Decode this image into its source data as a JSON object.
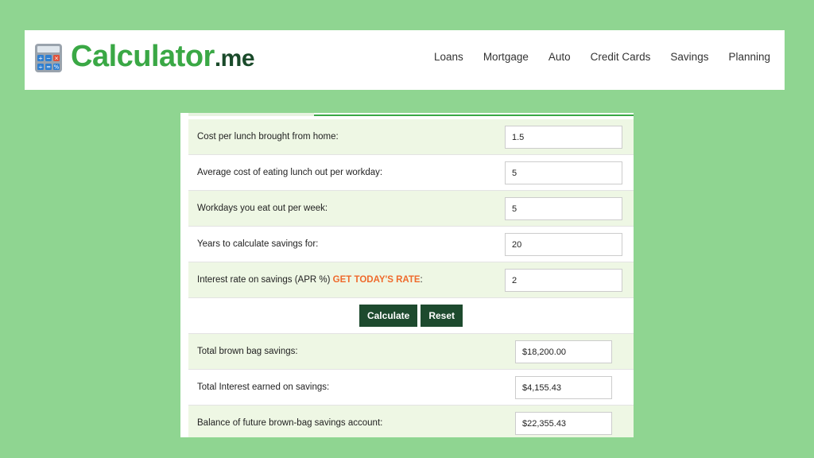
{
  "brand": {
    "name": "Calculator",
    "suffix": ".me"
  },
  "nav": [
    "Loans",
    "Mortgage",
    "Auto",
    "Credit Cards",
    "Savings",
    "Planning"
  ],
  "inputs": [
    {
      "label": "Cost per lunch brought from home:",
      "value": "1.5"
    },
    {
      "label": "Average cost of eating lunch out per workday:",
      "value": "5"
    },
    {
      "label": "Workdays you eat out per week:",
      "value": "5"
    },
    {
      "label": "Years to calculate savings for:",
      "value": "20"
    },
    {
      "label": "Interest rate on savings (APR %)",
      "link": "GET TODAY'S RATE",
      "after": ":",
      "value": "2"
    }
  ],
  "buttons": {
    "calculate": "Calculate",
    "reset": "Reset"
  },
  "results": [
    {
      "label": "Total brown bag savings:",
      "value": "$18,200.00"
    },
    {
      "label": "Total Interest earned on savings:",
      "value": "$4,155.43"
    },
    {
      "label": "Balance of future brown-bag savings account:",
      "value": "$22,355.43"
    }
  ],
  "colors": {
    "background": "#8fd591",
    "brand_green": "#3aa845",
    "brand_dark": "#1a4a2a",
    "button": "#1d4a2e",
    "link": "#ef6a2c"
  }
}
